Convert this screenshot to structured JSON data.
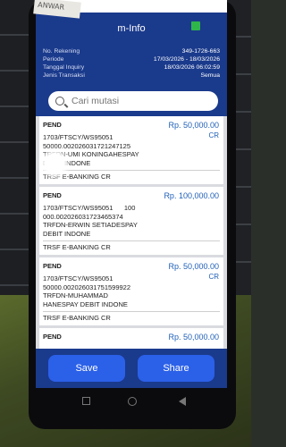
{
  "sticker": "ANWAR",
  "header": {
    "title": "m-Info"
  },
  "info": {
    "rows": [
      {
        "key": "No. Rekening",
        "value": "349-1726-663"
      },
      {
        "key": "Periode",
        "value": "17/03/2026 - 18/03/2026"
      },
      {
        "key": "Tanggal Inquiry",
        "value": "18/03/2026 06:02:59"
      },
      {
        "key": "Jenis Transaksi",
        "value": "Semua"
      }
    ]
  },
  "search": {
    "placeholder": "Cari mutasi"
  },
  "transactions": [
    {
      "status": "PEND",
      "amount": "Rp. 50,000.00",
      "dc": "CR",
      "description": "1703/FTSCY/WS95051\n50000.002026031721247125\nTRFDN-UMI KONINGAHESPAY\nDEBIT INDONE",
      "type": "TRSF E-BANKING CR"
    },
    {
      "status": "PEND",
      "amount": "Rp. 100,000.00",
      "dc": "CR",
      "description": "1703/FTSCY/WS95051      100\n000.002026031723465374\nTRFDN-ERWIN SETIADESPAY\nDEBIT INDONE",
      "type": "TRSF E-BANKING CR"
    },
    {
      "status": "PEND",
      "amount": "Rp. 50,000.00",
      "dc": "CR",
      "description": "1703/FTSCY/WS95051\n50000.002026031751599922\nTRFDN-MUHAMMAD\nHANESPAY DEBIT INDONE",
      "type": "TRSF E-BANKING CR"
    },
    {
      "status": "PEND",
      "amount": "Rp. 50,000.00",
      "dc": "",
      "description": "",
      "type": ""
    }
  ],
  "actions": {
    "save": "Save",
    "share": "Share"
  },
  "colors": {
    "primary": "#1a3a8c",
    "button": "#2b60e8",
    "amount": "#1f5fb8",
    "status_indicator": "#2fb64a"
  }
}
